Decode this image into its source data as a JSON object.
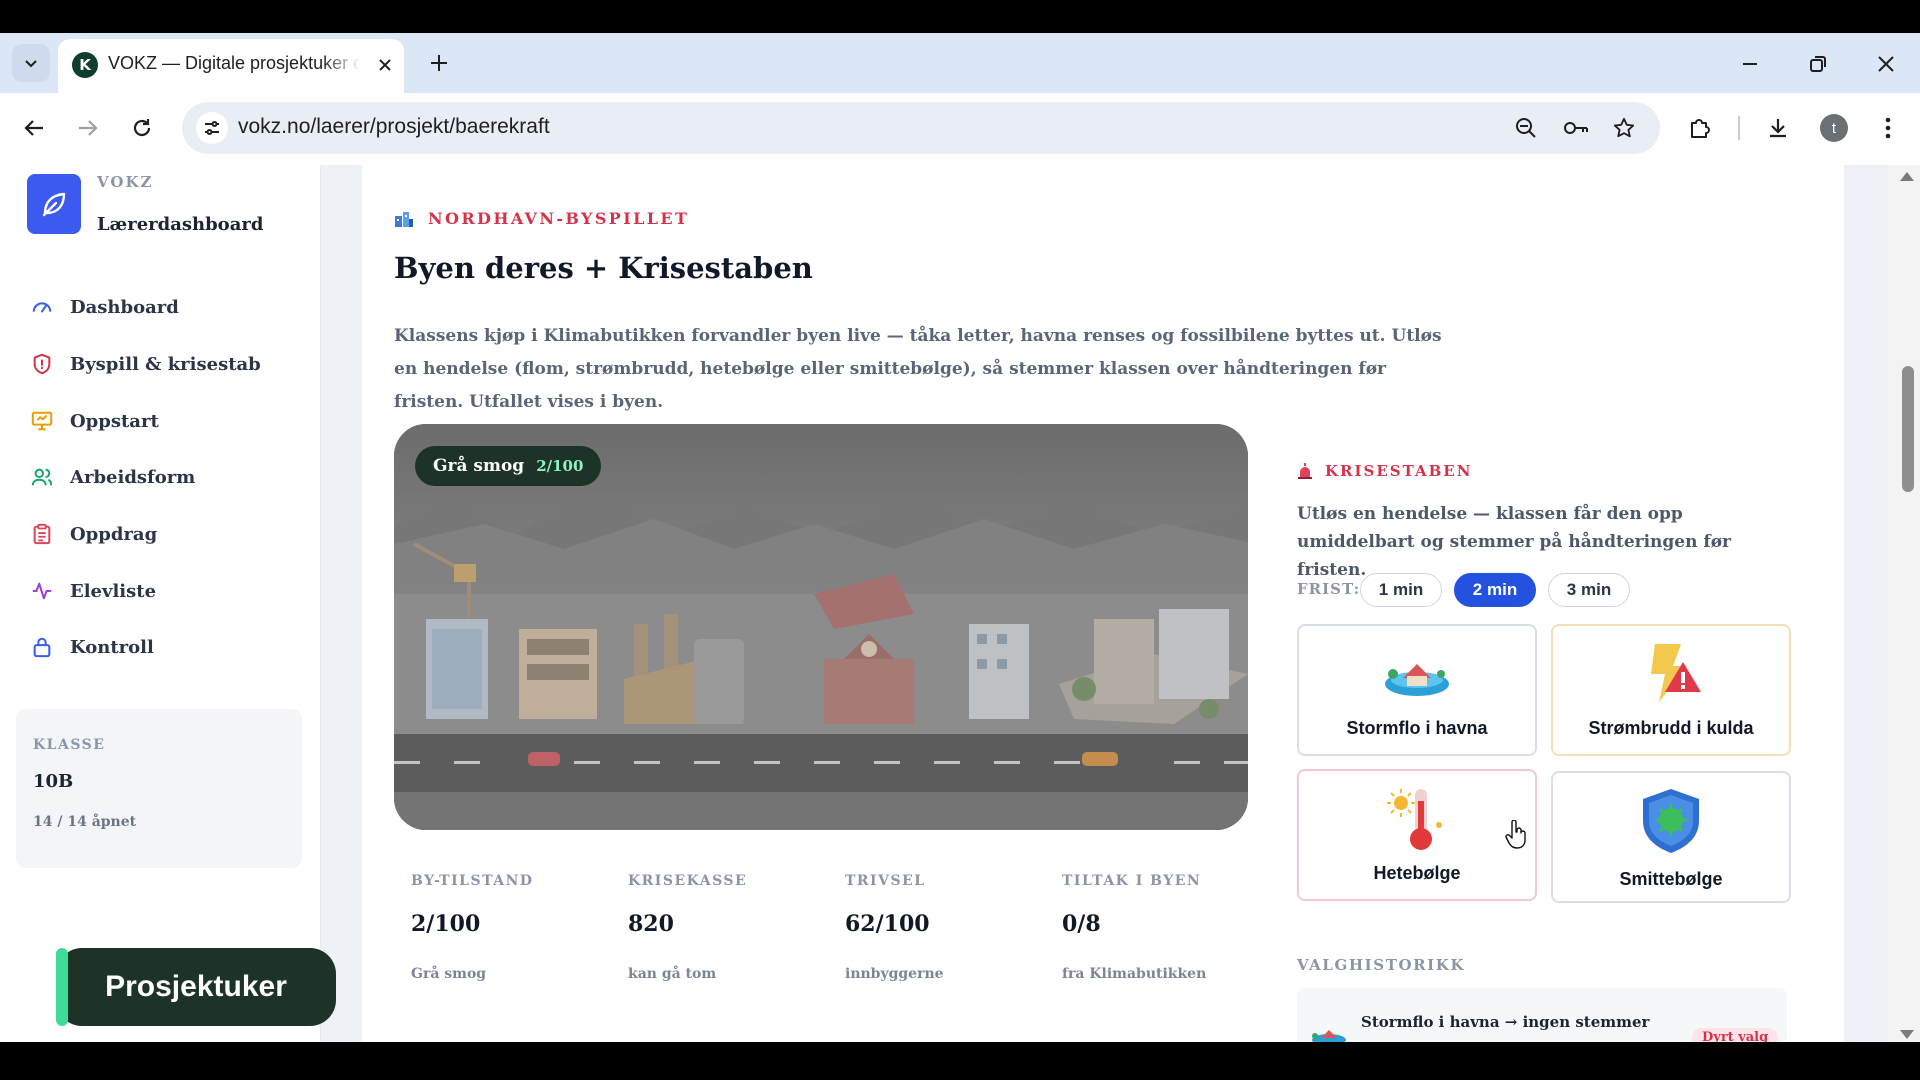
{
  "browser": {
    "tab_title": "VOKZ — Digitale prosjektuker og tverrfaglige opplegg",
    "favicon_letter": "K",
    "url": "vokz.no/laerer/prosjekt/baerekraft",
    "profile_initial": "t"
  },
  "sidebar": {
    "brand_name": "VOKZ",
    "brand_sub": "Lærerdashboard",
    "items": [
      {
        "label": "Dashboard",
        "icon": "gauge-icon",
        "color": "#3b5bf0"
      },
      {
        "label": "Byspill & krisestab",
        "icon": "shield-alert-icon",
        "color": "#d6334b"
      },
      {
        "label": "Oppstart",
        "icon": "presentation-icon",
        "color": "#e6a100"
      },
      {
        "label": "Arbeidsform",
        "icon": "users-icon",
        "color": "#18a46b"
      },
      {
        "label": "Oppdrag",
        "icon": "clipboard-icon",
        "color": "#e0445a"
      },
      {
        "label": "Elevliste",
        "icon": "activity-icon",
        "color": "#9b3fd6"
      },
      {
        "label": "Kontroll",
        "icon": "lock-icon",
        "color": "#3b5bf0"
      }
    ],
    "class_label": "KLASSE",
    "class_value": "10B",
    "class_open": "14 / 14 åpnet",
    "project_badge": "Prosjektuker"
  },
  "main": {
    "eyebrow": "NORDHAVN-BYSPILLET",
    "title": "Byen deres + Krisestaben",
    "lead": "Klassens kjøp i Klimabutikken forvandler byen live — tåka letter, havna renses og fossilbilene byttes ut. Utløs en hendelse (flom, strømbrudd, hetebølge eller smittebølge), så stemmer klassen over håndteringen før fristen. Utfallet vises i byen.",
    "scene_badge_label": "Grå smog",
    "scene_badge_score": "2/100",
    "stats": [
      {
        "label": "BY-TILSTAND",
        "value": "2/100",
        "sub": "Grå smog"
      },
      {
        "label": "KRISEKASSE",
        "value": "820",
        "sub": "kan gå tom"
      },
      {
        "label": "TRIVSEL",
        "value": "62/100",
        "sub": "innbyggerne"
      },
      {
        "label": "TILTAK I BYEN",
        "value": "0/8",
        "sub": "fra Klimabutikken"
      }
    ]
  },
  "crisis": {
    "eyebrow": "KRISESTABEN",
    "description": "Utløs en hendelse — klassen får den opp umiddelbart og stemmer på håndteringen før fristen.",
    "frist_label": "FRIST:",
    "durations": [
      "1 min",
      "2 min",
      "3 min"
    ],
    "selected_duration": "2 min",
    "events": [
      {
        "label": "Stormflo i havna",
        "icon": "flood-house-icon",
        "border": "#d9dee7"
      },
      {
        "label": "Strømbrudd i kulda",
        "icon": "power-outage-icon",
        "border": "#f3dfb8"
      },
      {
        "label": "Hetebølge",
        "icon": "thermometer-icon",
        "border": "#f1c9cf"
      },
      {
        "label": "Smittebølge",
        "icon": "virus-shield-icon",
        "border": "#d9dee7"
      }
    ],
    "history_title": "VALGHISTORIKK",
    "history": [
      {
        "text": "Stormflo i havna → ingen stemmer",
        "tag": "Dyrt valg"
      }
    ]
  }
}
